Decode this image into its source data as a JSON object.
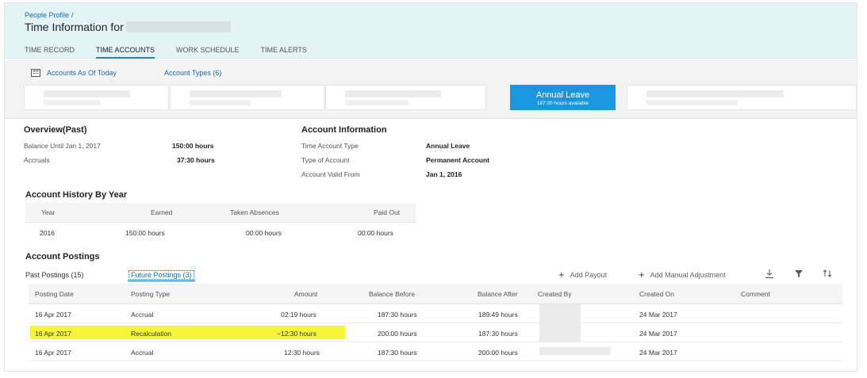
{
  "header": {
    "breadcrumb": "People Profile",
    "breadcrumb_sep": "/",
    "title": "Time Information for",
    "tabs": [
      "TIME RECORD",
      "TIME ACCOUNTS",
      "WORK SCHEDULE",
      "TIME ALERTS"
    ],
    "active_tab": 1
  },
  "subbar": {
    "accounts_as_of": "Accounts As Of Today",
    "account_types": "Account Types (6)",
    "active_card": {
      "title": "Annual Leave",
      "subtitle": "187:30 hours available"
    }
  },
  "overview": {
    "title": "Overview(Past)",
    "rows": [
      {
        "label": "Balance Until Jan 1, 2017",
        "value": "150:00 hours"
      },
      {
        "label": "Accruals",
        "value": "37:30 hours"
      }
    ]
  },
  "account_info": {
    "title": "Account Information",
    "rows": [
      {
        "label": "Time Account Type",
        "value": "Annual Leave"
      },
      {
        "label": "Type of Account",
        "value": "Permanent Account"
      },
      {
        "label": "Account Valid From",
        "value": "Jan 1, 2016"
      }
    ]
  },
  "history": {
    "title": "Account History By Year",
    "columns": [
      "Year",
      "Earned",
      "Taken Absences",
      "Paid Out"
    ],
    "rows": [
      [
        "2016",
        "150:00 hours",
        "00:00 hours",
        "00:00 hours"
      ]
    ]
  },
  "postings": {
    "title": "Account Postings",
    "tabs": [
      "Past Postings (15)",
      "Future Postings (3)"
    ],
    "active_tab": 1,
    "actions": {
      "add_payout": "Add Payout",
      "add_manual": "Add Manual Adjustment"
    },
    "icons": [
      "download-icon",
      "filter-icon",
      "sort-icon"
    ],
    "columns": [
      "Posting Date",
      "Posting Type",
      "Amount",
      "Balance Before",
      "Balance After",
      "Created By",
      "Created On",
      "Comment"
    ],
    "rows": [
      [
        "16 Apr 2017",
        "Accrual",
        "02:19 hours",
        "187:30 hours",
        "189:49 hours",
        "",
        "24 Mar 2017",
        ""
      ],
      [
        "16 Apr 2017",
        "Recalculation",
        "−12:30 hours",
        "200:00 hours",
        "187:30 hours",
        "",
        "24 Mar 2017",
        ""
      ],
      [
        "16 Apr 2017",
        "Accrual",
        "12:30 hours",
        "187:30 hours",
        "200:00 hours",
        "",
        "24 Mar 2017",
        ""
      ]
    ],
    "highlight_color": "#f5f53a"
  },
  "colors": {
    "accent": "#1996e0",
    "link": "#1a6ea8",
    "header_bg": "#e3f3f6"
  }
}
